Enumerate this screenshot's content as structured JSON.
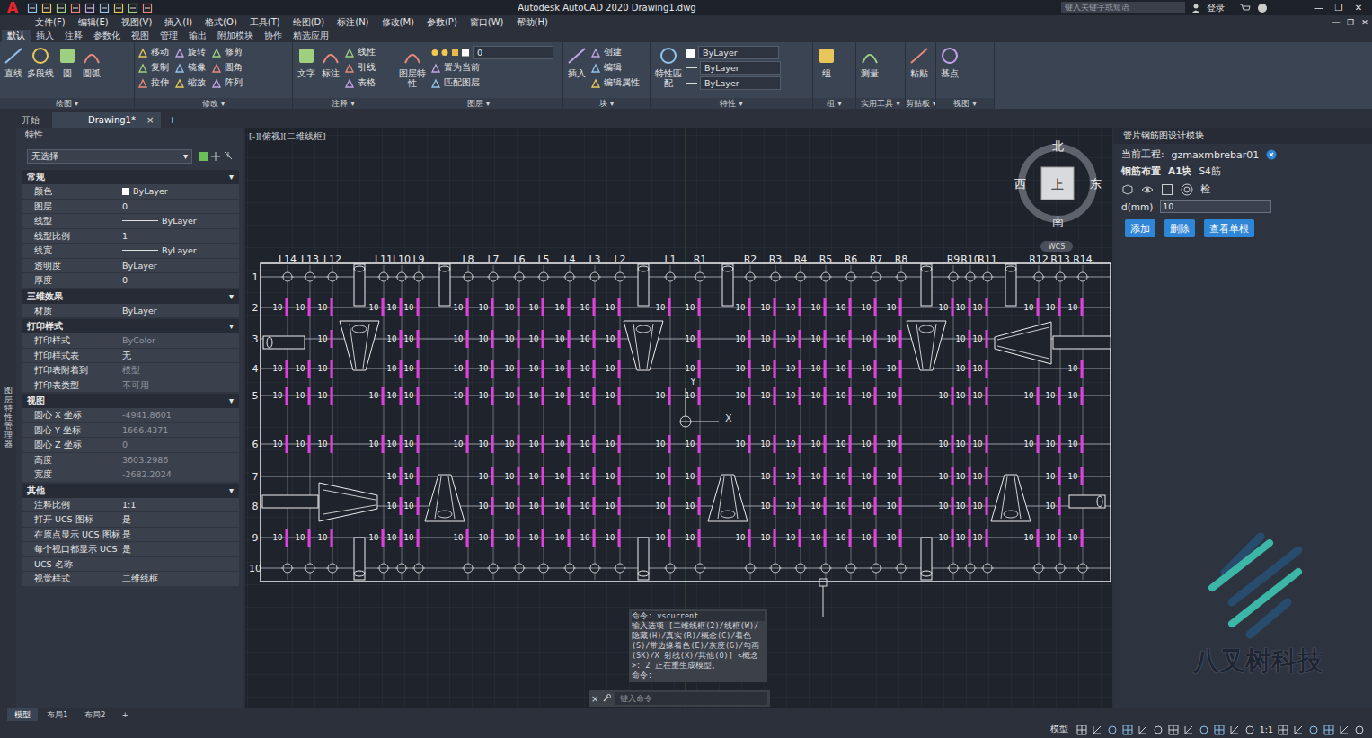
{
  "window": {
    "app_logo": "A",
    "title": "Autodesk AutoCAD 2020    Drawing1.dwg",
    "search": {
      "placeholder": "键入关键字或短语"
    },
    "login": "登录",
    "controls": [
      "—",
      "❐",
      "✕"
    ]
  },
  "menu": {
    "items": [
      "文件(F)",
      "编辑(E)",
      "视图(V)",
      "插入(I)",
      "格式(O)",
      "工具(T)",
      "绘图(D)",
      "标注(N)",
      "修改(M)",
      "参数(P)",
      "窗口(W)",
      "帮助(H)"
    ],
    "controls": [
      "—",
      "❐",
      "✕"
    ]
  },
  "ribbon": {
    "tabs": [
      {
        "label": "默认",
        "selected": true
      },
      {
        "label": "插入",
        "selected": false
      },
      {
        "label": "注释",
        "selected": false
      },
      {
        "label": "参数化",
        "selected": false
      },
      {
        "label": "视图",
        "selected": false
      },
      {
        "label": "管理",
        "selected": false
      },
      {
        "label": "输出",
        "selected": false
      },
      {
        "label": "附加模块",
        "selected": false
      },
      {
        "label": "协作",
        "selected": false
      },
      {
        "label": "精选应用",
        "selected": false
      }
    ],
    "group_toggle": "▾",
    "groups": [
      {
        "label": "绘图",
        "tools": [
          {
            "label": "直线",
            "kind": "large"
          },
          {
            "label": "多段线",
            "kind": "large"
          },
          {
            "label": "圆",
            "kind": "large"
          },
          {
            "label": "圆弧",
            "kind": "large"
          }
        ]
      },
      {
        "label": "修改",
        "tools": [
          {
            "label": "移动",
            "kind": "small"
          },
          {
            "label": "复制",
            "kind": "small"
          },
          {
            "label": "拉伸",
            "kind": "small"
          },
          {
            "label": "旋转",
            "kind": "small"
          },
          {
            "label": "镜像",
            "kind": "small"
          },
          {
            "label": "缩放",
            "kind": "small"
          },
          {
            "label": "修剪",
            "kind": "small"
          },
          {
            "label": "圆角",
            "kind": "small"
          },
          {
            "label": "阵列",
            "kind": "small"
          }
        ]
      },
      {
        "label": "注释",
        "tools": [
          {
            "label": "文字",
            "kind": "large"
          },
          {
            "label": "标注",
            "kind": "large"
          },
          {
            "label": "线性",
            "kind": "small"
          },
          {
            "label": "引线",
            "kind": "small"
          },
          {
            "label": "表格",
            "kind": "small"
          }
        ]
      },
      {
        "label": "图层",
        "tools": [
          {
            "label": "图层特性",
            "kind": "large"
          },
          {
            "label": "0",
            "kind": "layer-dropdown"
          },
          {
            "label": "置为当前",
            "kind": "small"
          },
          {
            "label": "匹配图层",
            "kind": "small"
          }
        ]
      },
      {
        "label": "块",
        "tools": [
          {
            "label": "插入",
            "kind": "large"
          },
          {
            "label": "创建",
            "kind": "small"
          },
          {
            "label": "编辑",
            "kind": "small"
          },
          {
            "label": "编辑属性",
            "kind": "small"
          }
        ]
      },
      {
        "label": "特性",
        "tools": [
          {
            "label": "特性匹配",
            "kind": "large"
          },
          {
            "label": "ByLayer",
            "kind": "color-dropdown"
          },
          {
            "label": "ByLayer",
            "kind": "line-dropdown"
          },
          {
            "label": "ByLayer",
            "kind": "line-dropdown"
          }
        ]
      },
      {
        "label": "组",
        "tools": [
          {
            "label": "组",
            "kind": "large"
          }
        ]
      },
      {
        "label": "实用工具",
        "tools": [
          {
            "label": "测量",
            "kind": "large"
          }
        ]
      },
      {
        "label": "剪贴板",
        "tools": [
          {
            "label": "粘贴",
            "kind": "large"
          }
        ]
      },
      {
        "label": "视图",
        "tools": [
          {
            "label": "基点",
            "kind": "large"
          }
        ]
      }
    ]
  },
  "file_tabs": {
    "tabs": [
      {
        "label": "开始",
        "selected": false
      },
      {
        "label": "Drawing1*",
        "selected": true
      }
    ],
    "close": "×",
    "add": "+"
  },
  "side_handle": "图层特性管理器",
  "properties": {
    "title": "特性",
    "selection": "无选择",
    "section_toggle": "▾",
    "sections": [
      {
        "title": "常规",
        "rows": [
          {
            "label": "颜色",
            "value": "ByLayer",
            "kind": "color",
            "greyed": false
          },
          {
            "label": "图层",
            "value": "0",
            "kind": "text",
            "greyed": false
          },
          {
            "label": "线型",
            "value": "ByLayer",
            "kind": "line",
            "greyed": false
          },
          {
            "label": "线型比例",
            "value": "1",
            "kind": "text",
            "greyed": false
          },
          {
            "label": "线宽",
            "value": "ByLayer",
            "kind": "line",
            "greyed": false
          },
          {
            "label": "透明度",
            "value": "ByLayer",
            "kind": "text",
            "greyed": false
          },
          {
            "label": "厚度",
            "value": "0",
            "kind": "text",
            "greyed": false
          }
        ]
      },
      {
        "title": "三维效果",
        "rows": [
          {
            "label": "材质",
            "value": "ByLayer",
            "kind": "text",
            "greyed": false
          }
        ]
      },
      {
        "title": "打印样式",
        "rows": [
          {
            "label": "打印样式",
            "value": "ByColor",
            "kind": "text",
            "greyed": true
          },
          {
            "label": "打印样式表",
            "value": "无",
            "kind": "text",
            "greyed": false
          },
          {
            "label": "打印表附着到",
            "value": "模型",
            "kind": "text",
            "greyed": true
          },
          {
            "label": "打印表类型",
            "value": "不可用",
            "kind": "text",
            "greyed": true
          }
        ]
      },
      {
        "title": "视图",
        "rows": [
          {
            "label": "圆心 X 坐标",
            "value": "-4941.8601",
            "kind": "text",
            "greyed": true
          },
          {
            "label": "圆心 Y 坐标",
            "value": "1666.4371",
            "kind": "text",
            "greyed": true
          },
          {
            "label": "圆心 Z 坐标",
            "value": "0",
            "kind": "text",
            "greyed": true
          },
          {
            "label": "高度",
            "value": "3603.2986",
            "kind": "text",
            "greyed": true
          },
          {
            "label": "宽度",
            "value": "-2682.2024",
            "kind": "text",
            "greyed": true
          }
        ]
      },
      {
        "title": "其他",
        "rows": [
          {
            "label": "注释比例",
            "value": "1:1",
            "kind": "text",
            "greyed": false
          },
          {
            "label": "打开 UCS 图标",
            "value": "是",
            "kind": "text",
            "greyed": false
          },
          {
            "label": "在原点显示 UCS 图标",
            "value": "是",
            "kind": "text",
            "greyed": false
          },
          {
            "label": "每个视口都显示 UCS",
            "value": "是",
            "kind": "text",
            "greyed": false
          },
          {
            "label": "UCS 名称",
            "value": "",
            "kind": "text",
            "greyed": false
          },
          {
            "label": "视觉样式",
            "value": "二维线框",
            "kind": "text",
            "greyed": false
          }
        ]
      }
    ]
  },
  "drawing": {
    "viewport_label": "[-][俯视][二维线框]",
    "column_labels": [
      "L14",
      "L13",
      "L12",
      "L11",
      "L10",
      "L9",
      "L8",
      "L7",
      "L6",
      "L5",
      "L4",
      "L3",
      "L2",
      "L1",
      "R1",
      "R2",
      "R3",
      "R4",
      "R5",
      "R6",
      "R7",
      "R8",
      "R9",
      "R10",
      "R11",
      "R12",
      "R13",
      "R14"
    ],
    "row_labels": [
      "1",
      "2",
      "3",
      "4",
      "5",
      "6",
      "7",
      "8",
      "9",
      "10"
    ],
    "rebar_label": "10",
    "ucs": {
      "x": "X",
      "y": "Y"
    },
    "viewcube": {
      "north": "北",
      "south": "南",
      "east": "东",
      "west": "西",
      "face": "上",
      "wcs": "WCS"
    }
  },
  "command": {
    "history": [
      "命令: vscurrent",
      "输入选项 [二维线框(2)/线框(W)/隐藏(H)/真实(R)/概念(C)/着色(S)/带边缘着色(E)/灰度(G)/勾画(SK)/X 射线(X)/其他(O)] <概念>: 2 正在重生成模型。",
      "命令:"
    ],
    "placeholder": "键入命令",
    "close": "×"
  },
  "plugin": {
    "title": "管片钢筋图设计模块",
    "project_label": "当前工程:",
    "project": "gzmaxmbrebar01",
    "breadcrumb": [
      {
        "label": "钢筋布置",
        "emphasis": true
      },
      {
        "label": "A1块",
        "emphasis": true
      },
      {
        "label": "S4筋",
        "emphasis": false
      }
    ],
    "check": "检",
    "field": {
      "label": "d(mm)",
      "value": "10"
    },
    "buttons": [
      "添加",
      "删除",
      "查看单根"
    ],
    "brand": "八叉树科技"
  },
  "layout_tabs": {
    "tabs": [
      {
        "label": "模型",
        "selected": true
      },
      {
        "label": "布局1",
        "selected": false
      },
      {
        "label": "布局2",
        "selected": false
      }
    ],
    "add": "+"
  },
  "status_bar": {
    "mode": "模型",
    "scale": "1:1"
  }
}
